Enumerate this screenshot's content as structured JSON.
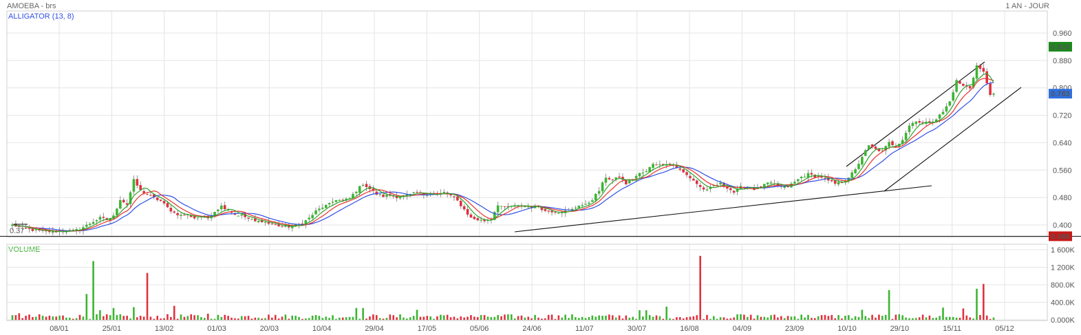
{
  "header": {
    "symbol_title": "AMOEBA - brs",
    "period": "1 AN - JOUR"
  },
  "indicators": {
    "alligator_label": "ALLIGATOR (13, 8)",
    "volume_label": "VOLUME"
  },
  "colors": {
    "up": "#3cb532",
    "down": "#e0313f",
    "jaw": "#2f4fe6",
    "teeth": "#e8302c",
    "lips": "#2ea12a",
    "grid": "#e4e4e4",
    "last_price_tag": "#2f6fe0",
    "high_tag": "#1a8a1a",
    "low_tag": "#c81818"
  },
  "chart_data": [
    {
      "type": "candlestick",
      "x_labels": [
        "08/01",
        "25/01",
        "13/02",
        "01/03",
        "20/03",
        "10/04",
        "29/04",
        "17/05",
        "05/06",
        "24/06",
        "11/07",
        "30/07",
        "16/08",
        "04/09",
        "23/09",
        "10/10",
        "29/10",
        "15/11",
        "05/12"
      ],
      "ylim": [
        0.37,
        0.99
      ],
      "y_ticks": [
        "0.960",
        "0.880",
        "0.800",
        "0.720",
        "0.640",
        "0.560",
        "0.480",
        "0.400"
      ],
      "price_tags": {
        "high": "0.920",
        "last": "0.783",
        "low": "0.365"
      },
      "low_line_label": "0.37",
      "lows": {
        "price": 0.365
      },
      "close_anchors": [
        [
          0,
          0.4
        ],
        [
          4,
          0.388
        ],
        [
          8,
          0.382
        ],
        [
          12,
          0.38
        ],
        [
          16,
          0.384
        ],
        [
          18,
          0.382
        ],
        [
          20,
          0.388
        ],
        [
          24,
          0.41
        ],
        [
          26,
          0.42
        ],
        [
          28,
          0.415
        ],
        [
          30,
          0.425
        ],
        [
          32,
          0.475
        ],
        [
          34,
          0.46
        ],
        [
          36,
          0.53
        ],
        [
          38,
          0.5
        ],
        [
          40,
          0.49
        ],
        [
          42,
          0.478
        ],
        [
          44,
          0.47
        ],
        [
          46,
          0.45
        ],
        [
          48,
          0.435
        ],
        [
          50,
          0.428
        ],
        [
          52,
          0.43
        ],
        [
          54,
          0.42
        ],
        [
          56,
          0.425
        ],
        [
          58,
          0.42
        ],
        [
          60,
          0.44
        ],
        [
          62,
          0.455
        ],
        [
          64,
          0.445
        ],
        [
          66,
          0.43
        ],
        [
          68,
          0.428
        ],
        [
          70,
          0.418
        ],
        [
          72,
          0.41
        ],
        [
          74,
          0.412
        ],
        [
          76,
          0.404
        ],
        [
          80,
          0.396
        ],
        [
          82,
          0.395
        ],
        [
          84,
          0.398
        ],
        [
          86,
          0.405
        ],
        [
          88,
          0.42
        ],
        [
          90,
          0.44
        ],
        [
          92,
          0.452
        ],
        [
          94,
          0.46
        ],
        [
          96,
          0.475
        ],
        [
          98,
          0.47
        ],
        [
          100,
          0.478
        ],
        [
          102,
          0.5
        ],
        [
          104,
          0.52
        ],
        [
          106,
          0.505
        ],
        [
          108,
          0.49
        ],
        [
          110,
          0.484
        ],
        [
          112,
          0.486
        ],
        [
          114,
          0.482
        ],
        [
          116,
          0.485
        ],
        [
          118,
          0.488
        ],
        [
          120,
          0.495
        ],
        [
          122,
          0.49
        ],
        [
          124,
          0.492
        ],
        [
          126,
          0.488
        ],
        [
          128,
          0.495
        ],
        [
          130,
          0.485
        ],
        [
          132,
          0.47
        ],
        [
          134,
          0.445
        ],
        [
          136,
          0.42
        ],
        [
          138,
          0.415
        ],
        [
          140,
          0.412
        ],
        [
          142,
          0.418
        ],
        [
          144,
          0.46
        ],
        [
          146,
          0.45
        ],
        [
          148,
          0.455
        ],
        [
          150,
          0.455
        ],
        [
          152,
          0.455
        ],
        [
          154,
          0.452
        ],
        [
          156,
          0.455
        ],
        [
          158,
          0.44
        ],
        [
          160,
          0.44
        ],
        [
          162,
          0.438
        ],
        [
          164,
          0.44
        ],
        [
          166,
          0.445
        ],
        [
          168,
          0.458
        ],
        [
          170,
          0.458
        ],
        [
          172,
          0.475
        ],
        [
          174,
          0.5
        ],
        [
          176,
          0.54
        ],
        [
          178,
          0.53
        ],
        [
          180,
          0.54
        ],
        [
          182,
          0.52
        ],
        [
          184,
          0.535
        ],
        [
          186,
          0.55
        ],
        [
          188,
          0.555
        ],
        [
          190,
          0.58
        ],
        [
          192,
          0.575
        ],
        [
          194,
          0.58
        ],
        [
          196,
          0.575
        ],
        [
          198,
          0.56
        ],
        [
          200,
          0.545
        ],
        [
          202,
          0.53
        ],
        [
          204,
          0.51
        ],
        [
          206,
          0.5
        ],
        [
          208,
          0.515
        ],
        [
          210,
          0.52
        ],
        [
          212,
          0.51
        ],
        [
          214,
          0.495
        ],
        [
          216,
          0.51
        ],
        [
          218,
          0.512
        ],
        [
          220,
          0.505
        ],
        [
          222,
          0.51
        ],
        [
          224,
          0.522
        ],
        [
          226,
          0.518
        ],
        [
          228,
          0.51
        ],
        [
          230,
          0.512
        ],
        [
          232,
          0.525
        ],
        [
          234,
          0.54
        ],
        [
          236,
          0.548
        ],
        [
          238,
          0.542
        ],
        [
          240,
          0.54
        ],
        [
          242,
          0.528
        ],
        [
          244,
          0.52
        ],
        [
          246,
          0.525
        ],
        [
          248,
          0.54
        ],
        [
          250,
          0.56
        ],
        [
          252,
          0.6
        ],
        [
          254,
          0.63
        ],
        [
          256,
          0.62
        ],
        [
          258,
          0.615
        ],
        [
          260,
          0.64
        ],
        [
          262,
          0.63
        ],
        [
          264,
          0.65
        ],
        [
          266,
          0.69
        ],
        [
          268,
          0.705
        ],
        [
          270,
          0.695
        ],
        [
          272,
          0.7
        ],
        [
          274,
          0.71
        ],
        [
          276,
          0.73
        ],
        [
          278,
          0.76
        ],
        [
          280,
          0.82
        ],
        [
          282,
          0.805
        ],
        [
          284,
          0.8
        ],
        [
          286,
          0.865
        ],
        [
          288,
          0.845
        ],
        [
          290,
          0.783
        ]
      ]
    },
    {
      "type": "bar",
      "name": "VOLUME",
      "ylim": [
        0,
        1700000
      ],
      "y_ticks": [
        "1 600K",
        "1 200K",
        "800.0K",
        "400.0K",
        "0.000K"
      ],
      "spikes": [
        [
          2,
          150000
        ],
        [
          22,
          590000
        ],
        [
          24,
          1340000
        ],
        [
          26,
          220000
        ],
        [
          30,
          270000
        ],
        [
          36,
          290000
        ],
        [
          40,
          1070000
        ],
        [
          48,
          320000
        ],
        [
          58,
          140000
        ],
        [
          76,
          120000
        ],
        [
          102,
          270000
        ],
        [
          104,
          270000
        ],
        [
          120,
          230000
        ],
        [
          140,
          110000
        ],
        [
          160,
          120000
        ],
        [
          182,
          100000
        ],
        [
          186,
          220000
        ],
        [
          188,
          220000
        ],
        [
          194,
          300000
        ],
        [
          204,
          1460000
        ],
        [
          216,
          130000
        ],
        [
          234,
          120000
        ],
        [
          252,
          230000
        ],
        [
          260,
          680000
        ],
        [
          276,
          280000
        ],
        [
          282,
          260000
        ],
        [
          286,
          710000
        ],
        [
          288,
          820000
        ]
      ]
    }
  ]
}
